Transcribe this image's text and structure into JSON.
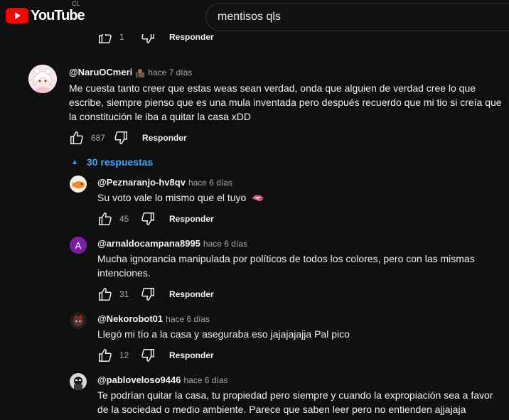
{
  "header": {
    "logo_text": "YouTube",
    "country_code": "CL",
    "search_value": "mentisos qls"
  },
  "previous_comment": {
    "like_count": "1",
    "reply_label": "Responder"
  },
  "main_comment": {
    "author": "@NaruOCmeri",
    "time": "hace 7 días",
    "text": "Me cuesta tanto creer que estas weas sean verdad, onda que alguien de verdad cree lo que escribe, siempre pienso que es una mula inventada pero después recuerdo que mi tio si creía que la constitución le iba a quitar la casa xDD",
    "like_count": "687",
    "reply_label": "Responder",
    "replies_toggle": "30 respuestas"
  },
  "replies": [
    {
      "author": "@Peznaranjo-hv8qv",
      "time": "hace 6 días",
      "text": "Su voto vale lo mismo que el tuyo",
      "emoji": "🫦",
      "like_count": "45",
      "reply_label": "Responder"
    },
    {
      "author": "@arnaldocampana8995",
      "time": "hace 6 días",
      "avatar_letter": "A",
      "avatar_color": "#7b1fa2",
      "text": "Mucha ignorancia manipulada por políticos  de todos los colores, pero con las mismas intenciones.",
      "like_count": "31",
      "reply_label": "Responder"
    },
    {
      "author": "@Nekorobot01",
      "time": "hace 6 días",
      "text": "Llegó mi tío a la casa y aseguraba eso jajajajajja Pal pico",
      "like_count": "12",
      "reply_label": "Responder"
    },
    {
      "author": "@pabloveloso9446",
      "time": "hace 6 días",
      "text": "Te podrían quitar la casa, tu propiedad pero siempre y cuando la expropiación sea a favor de la sociedad o medio ambiente. Parece que saben leer pero no entienden ajjajaja"
    }
  ],
  "colors": {
    "background": "#0f0f0f",
    "link_blue": "#3ea6ff",
    "youtube_red": "#ff0000"
  },
  "icons": [
    "youtube-logo-icon",
    "like-icon",
    "dislike-icon",
    "chevron-up-icon"
  ]
}
